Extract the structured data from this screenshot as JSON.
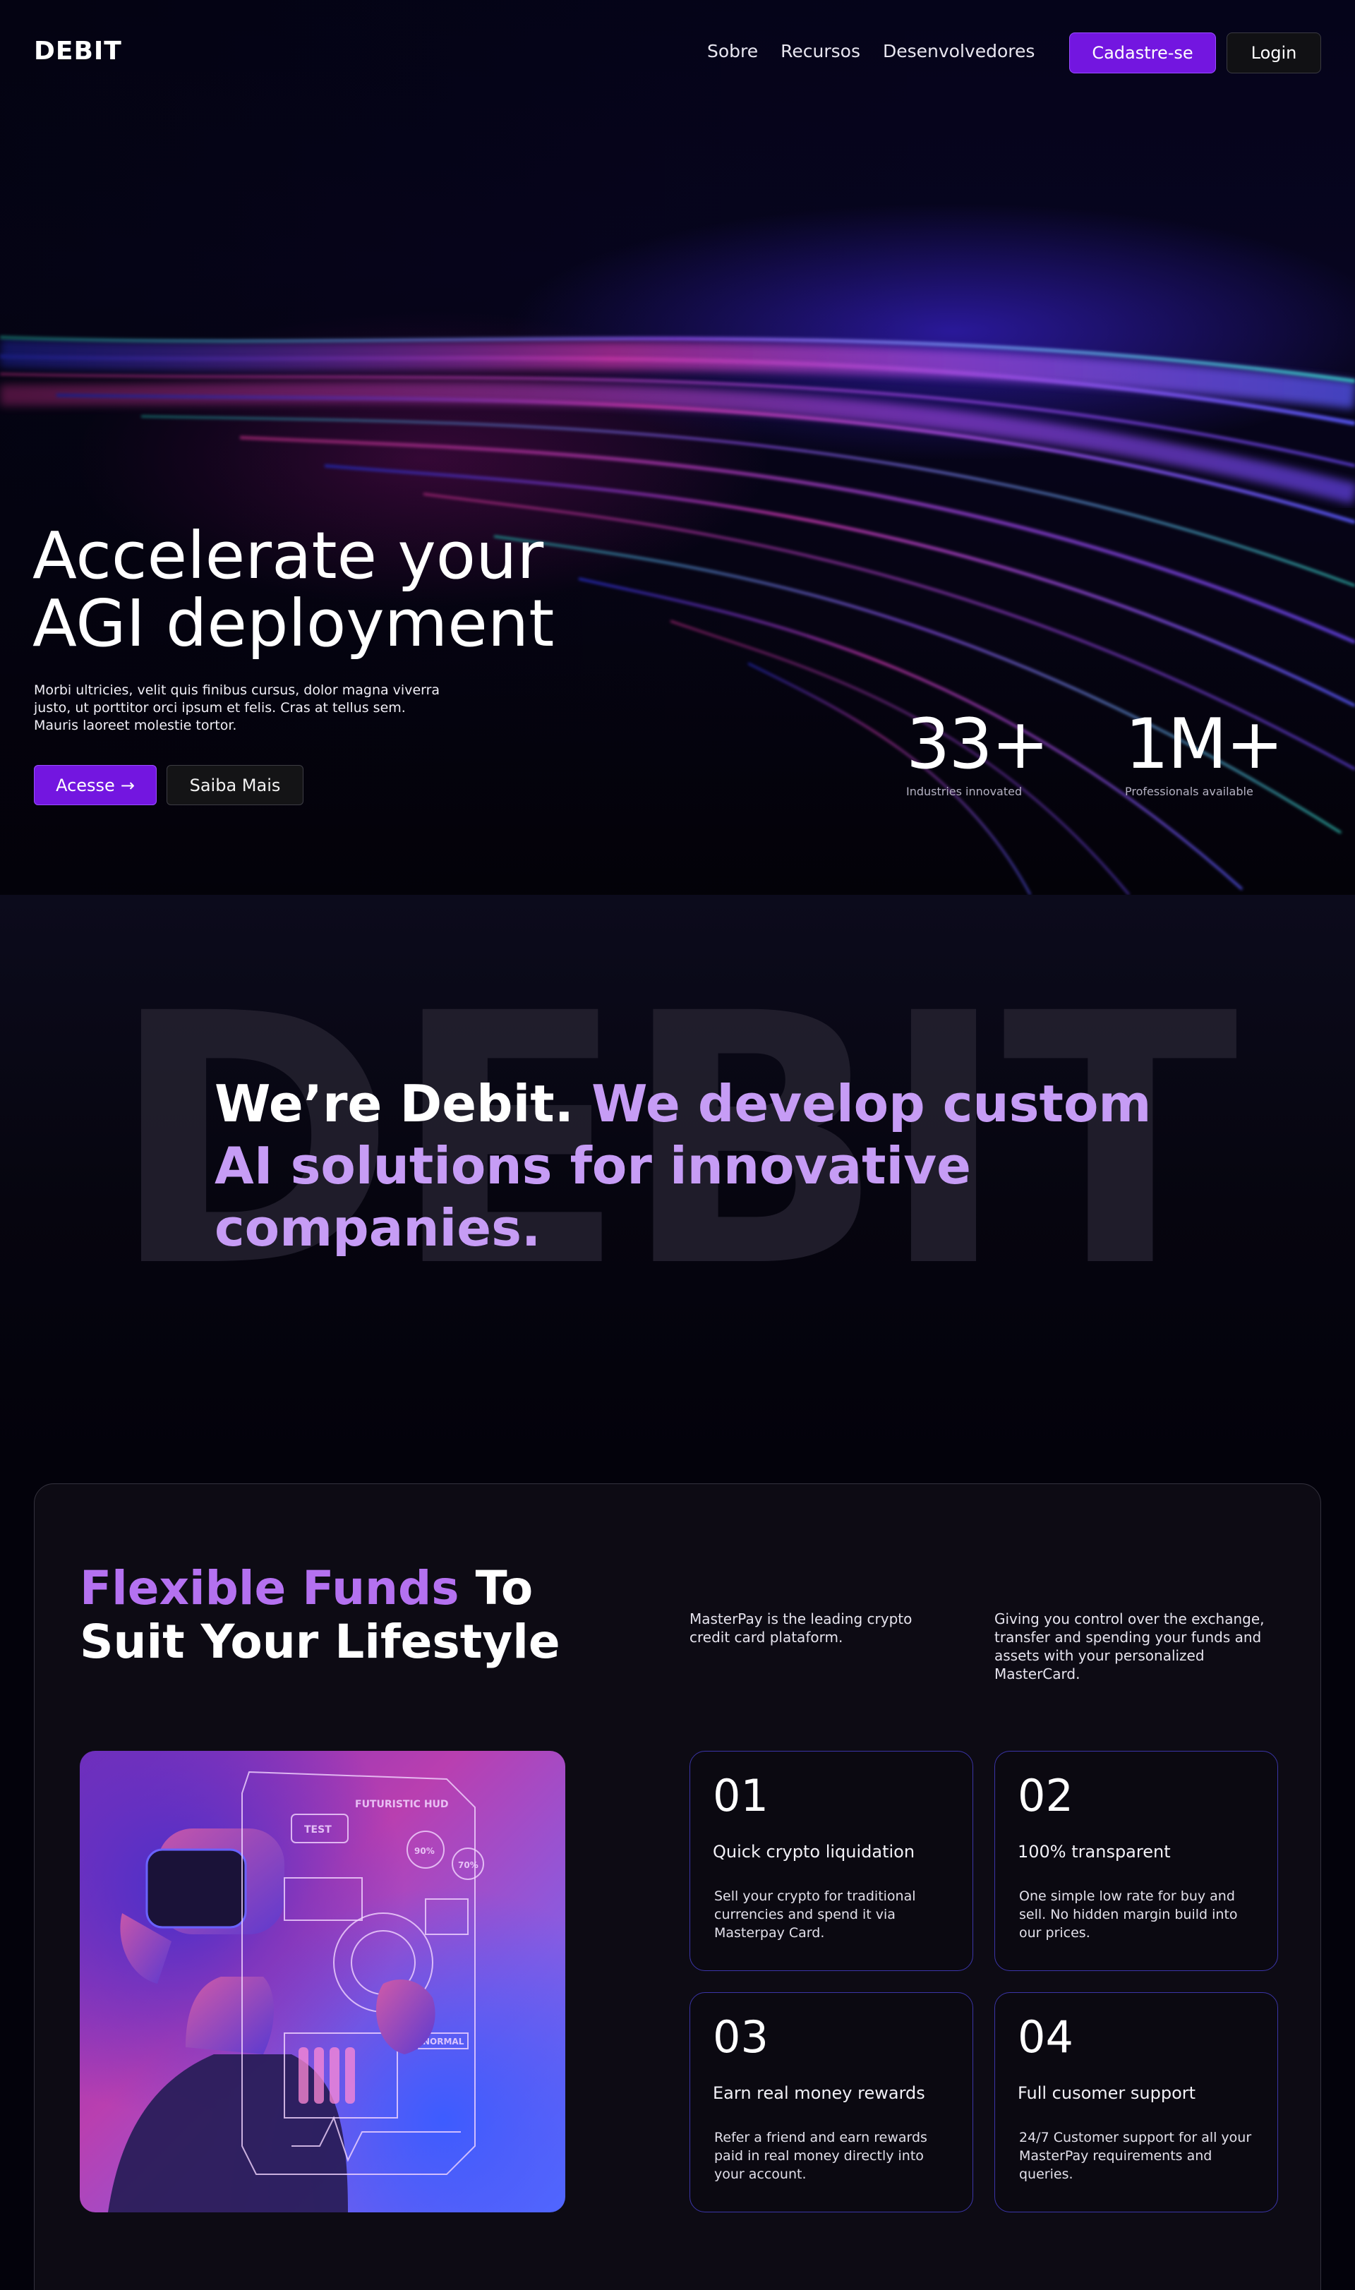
{
  "nav": {
    "logo": "DEBIT",
    "links": [
      "Sobre",
      "Recursos",
      "Desenvolvedores"
    ],
    "signup_label": "Cadastre-se",
    "login_label": "Login"
  },
  "hero": {
    "title_line1": "Accelerate your",
    "title_line2": "AGI deployment",
    "text": "Morbi ultricies, velit quis finibus cursus, dolor magna viverra justo, ut porttitor orci ipsum et felis. Cras at tellus sem. Mauris laoreet molestie tortor.",
    "access_label": "Acesse",
    "access_arrow": "→",
    "more_label": "Saiba Mais",
    "stats": [
      {
        "value": "33+",
        "label": "Industries innovated"
      },
      {
        "value": "1M+",
        "label": "Professionals available"
      }
    ]
  },
  "about": {
    "background_word": "DEBIT",
    "title_plain": "We’re Debit.",
    "title_accent": "We develop custom AI solutions for innovative companies."
  },
  "funds": {
    "title_accent": "Flexible Funds",
    "title_rest": "To Suit Your Lifestyle",
    "desc_left": "MasterPay is the leading crypto credit card plataform.",
    "desc_right": "Giving you control over the exchange, transfer and spending your funds and assets with your personalized MasterCard.",
    "image_labels": {
      "hud": "FUTURISTIC HUD",
      "test": "TEST",
      "pct1": "90%",
      "pct2": "70%",
      "normal": "NORMAL"
    },
    "features": [
      {
        "num": "01",
        "title": "Quick crypto liquidation",
        "text": "Sell your crypto for traditional currencies and spend it via Masterpay Card."
      },
      {
        "num": "02",
        "title": "100% transparent",
        "text": "One simple low rate for buy and sell. No hidden margin build into our prices."
      },
      {
        "num": "03",
        "title": "Earn real money rewards",
        "text": "Refer a friend and earn rewards paid in real money directly into your account."
      },
      {
        "num": "04",
        "title": "Full cusomer support",
        "text": "24/7 Customer support for all your MasterPay requirements and queries."
      }
    ]
  },
  "colors": {
    "accent": "#7316e0",
    "accent_text": "#c69cf5",
    "card_border": "#3b35a8",
    "background": "#03020b"
  }
}
